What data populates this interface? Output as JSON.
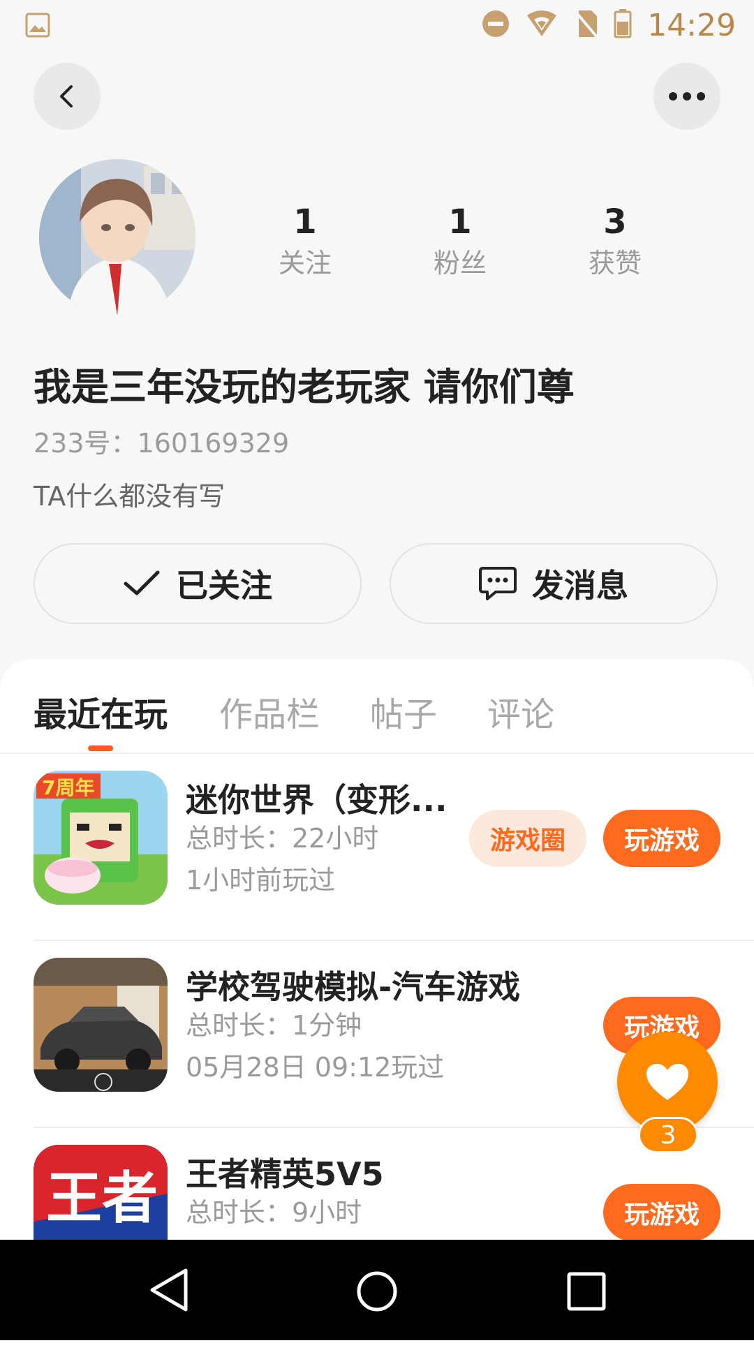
{
  "status_bar": {
    "time": "14:29"
  },
  "profile": {
    "stats": [
      {
        "value": "1",
        "label": "关注"
      },
      {
        "value": "1",
        "label": "粉丝"
      },
      {
        "value": "3",
        "label": "获赞"
      }
    ],
    "nickname": "我是三年没玩的老玩家 请你们尊",
    "uid": "233号：160169329",
    "bio": "TA什么都没有写",
    "follow_label": "已关注",
    "message_label": "发消息"
  },
  "tabs": [
    {
      "label": "最近在玩"
    },
    {
      "label": "作品栏"
    },
    {
      "label": "帖子"
    },
    {
      "label": "评论"
    }
  ],
  "games": [
    {
      "title": "迷你世界（变形...",
      "duration": "总时长：22小时",
      "last_played": "1小时前玩过",
      "circle_label": "游戏圈",
      "play_label": "玩游戏"
    },
    {
      "title": "学校驾驶模拟-汽车游戏",
      "duration": "总时长：1分钟",
      "last_played": "05月28日 09:12玩过",
      "play_label": "玩游戏"
    },
    {
      "title": "王者精英5V5",
      "duration": "总时长：9小时",
      "play_label": "玩游戏"
    }
  ],
  "like_fab": {
    "count": "3"
  },
  "colors": {
    "accent": "#ff6a1f",
    "fab": "#ff8a00",
    "status_text": "#b8874a"
  }
}
